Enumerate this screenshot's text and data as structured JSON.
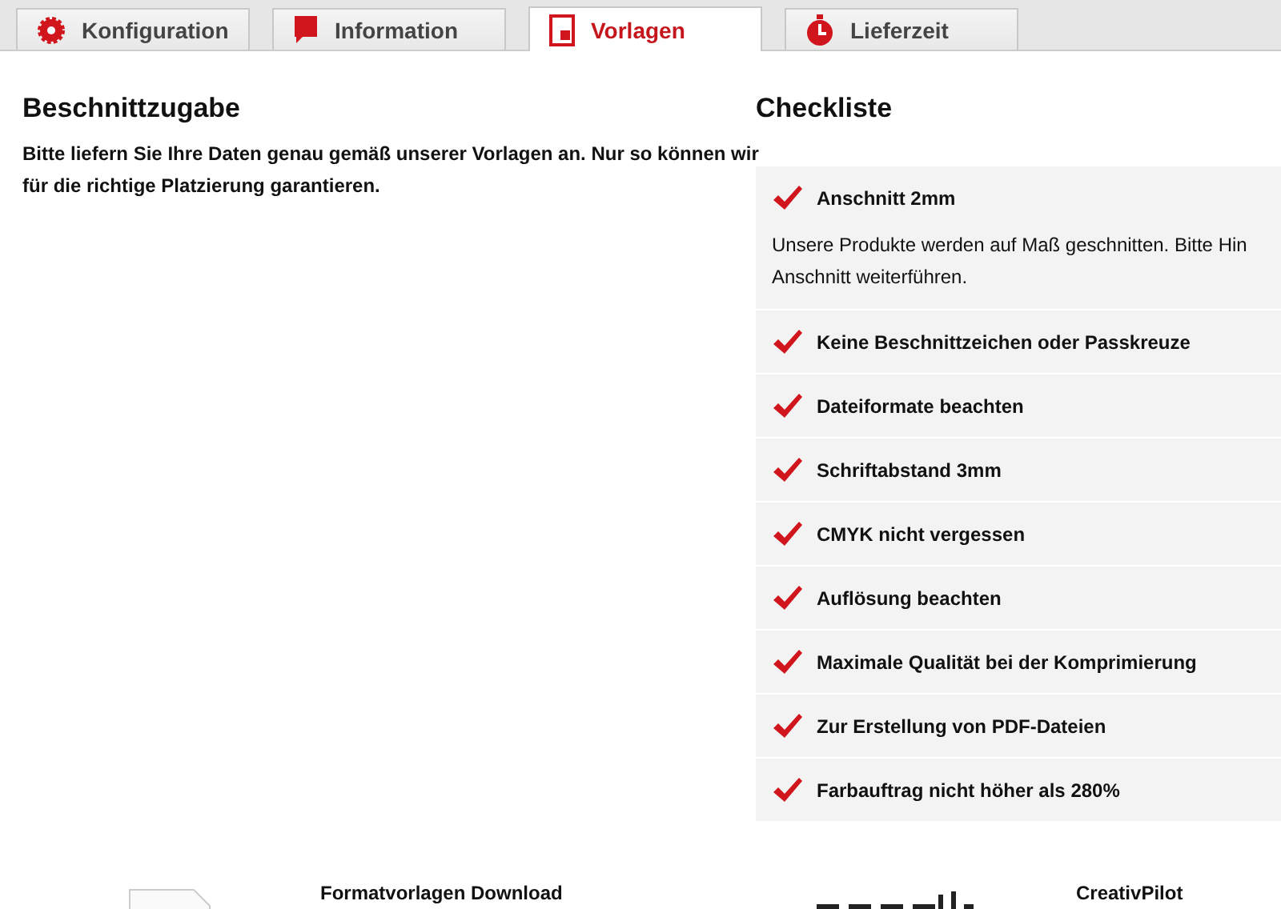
{
  "tabs": [
    {
      "label": "Konfiguration",
      "kind": "gear",
      "selected": false
    },
    {
      "label": "Information",
      "kind": "speech",
      "selected": false
    },
    {
      "label": "Vorlagen",
      "kind": "page",
      "selected": true
    },
    {
      "label": "Lieferzeit",
      "kind": "clock",
      "selected": false
    }
  ],
  "left": {
    "title": "Beschnittzugabe",
    "text": "Bitte liefern Sie Ihre Daten genau gemäß unserer Vorlagen an. Nur so können wir für die richtige Platzierung garantieren."
  },
  "checklist": {
    "title": "Checkliste",
    "items": [
      {
        "label": "Anschnitt 2mm",
        "expanded": true,
        "lines": [
          "Unsere Produkte werden auf Maß geschnitten. Bitte Hin",
          "Anschnitt weiterführen."
        ]
      },
      {
        "label": "Keine Beschnittzeichen oder Passkreuze",
        "expanded": false
      },
      {
        "label": "Dateiformate beachten",
        "expanded": false
      },
      {
        "label": "Schriftabstand 3mm",
        "expanded": false
      },
      {
        "label": "CMYK nicht vergessen",
        "expanded": false
      },
      {
        "label": "Auflösung beachten",
        "expanded": false
      },
      {
        "label": "Maximale Qualität bei der Komprimierung",
        "expanded": false
      },
      {
        "label": "Zur Erstellung von PDF-Dateien",
        "expanded": false
      },
      {
        "label": "Farbauftrag nicht höher als 280%",
        "expanded": false
      }
    ]
  },
  "downloads": [
    {
      "kind": "file",
      "title": "Formatvorlagen Download"
    },
    {
      "kind": "logo",
      "title": "CreativPilot"
    }
  ]
}
